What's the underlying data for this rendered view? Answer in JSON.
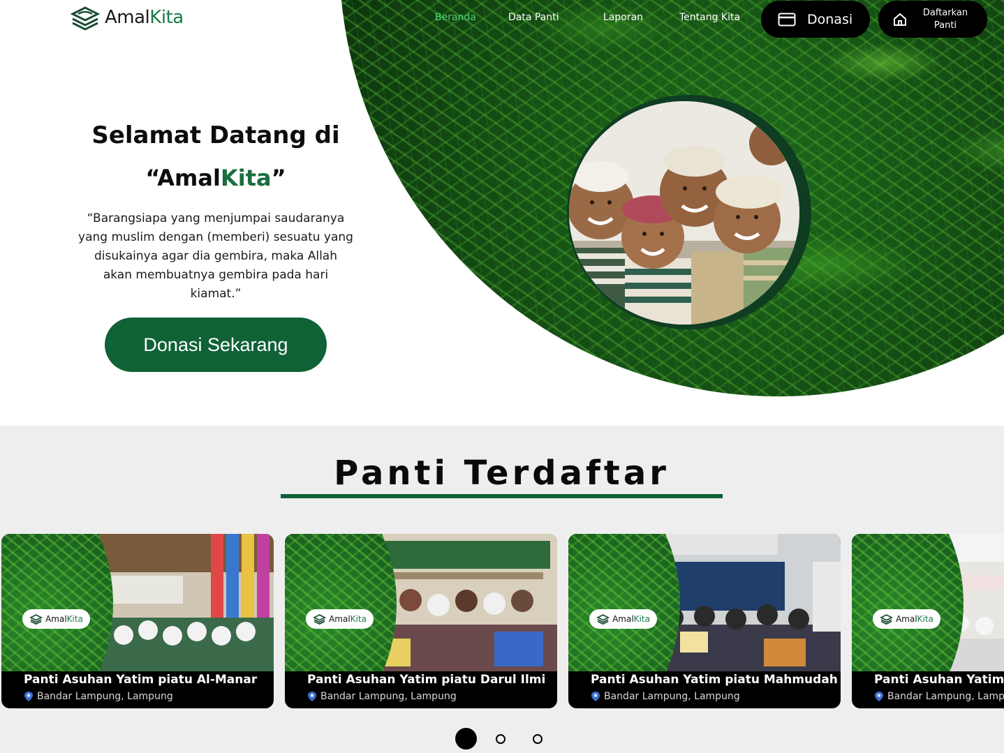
{
  "brand": {
    "name_part1": "Amal",
    "name_part2": "Kita"
  },
  "nav": {
    "links": [
      "Beranda",
      "Data Panti",
      "Laporan",
      "Tentang Kita"
    ],
    "active_index": 0,
    "donate_label": "Donasi",
    "register_label": "Daftarkan Panti"
  },
  "hero": {
    "title_line1": "Selamat Datang di",
    "title_line2_open": "“Amal",
    "title_line2_accent": "Kita",
    "title_line2_close": "”",
    "quote": "“Barangsiapa yang menjumpai saudaranya yang muslim dengan (memberi) sesuatu yang disukainya agar dia gembira, maka Allah akan membuatnya gembira pada hari kiamat.”",
    "cta_label": "Donasi Sekarang"
  },
  "section": {
    "title": "Panti Terdaftar",
    "cards": [
      {
        "name": "Panti Asuhan Yatim piatu Al-Manar",
        "location": "Bandar Lampung, Lampung"
      },
      {
        "name": "Panti Asuhan Yatim piatu Darul Ilmi",
        "location": "Bandar Lampung, Lampung"
      },
      {
        "name": "Panti Asuhan Yatim piatu Mahmudah",
        "location": "Bandar Lampung, Lampung"
      },
      {
        "name": "Panti Asuhan Yatim",
        "location": "Bandar Lampung, Lampung"
      }
    ],
    "carousel": {
      "pages": 3,
      "active": 0
    }
  },
  "colors": {
    "brand_green": "#0f6236",
    "accent_green": "#4ed37b",
    "dark": "#000000",
    "section_bg": "#efeeee"
  }
}
